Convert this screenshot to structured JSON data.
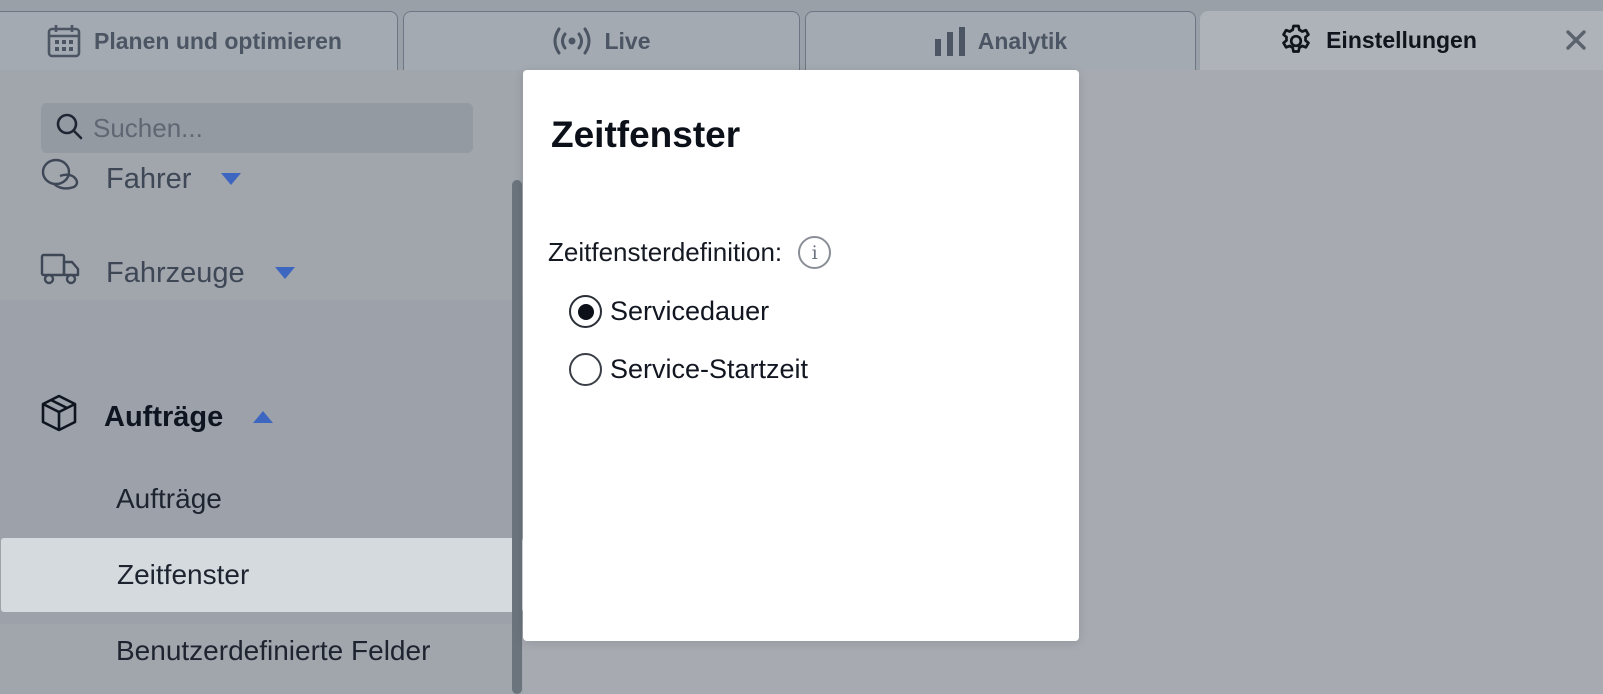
{
  "tabs": [
    {
      "label": "Planen und optimieren",
      "icon": "calendar-icon"
    },
    {
      "label": "Live",
      "icon": "broadcast-icon"
    },
    {
      "label": "Analytik",
      "icon": "bar-chart-icon"
    },
    {
      "label": "Einstellungen",
      "icon": "gear-icon",
      "active": true
    }
  ],
  "search": {
    "placeholder": "Suchen..."
  },
  "sidebar": {
    "items": [
      {
        "label": "Fahrer",
        "icon": "driver-icon",
        "expanded": false
      },
      {
        "label": "Fahrzeuge",
        "icon": "truck-icon",
        "expanded": false
      },
      {
        "label": "Aufträge",
        "icon": "package-icon",
        "expanded": true
      }
    ],
    "subitems": [
      {
        "label": "Aufträge"
      },
      {
        "label": "Zeitfenster",
        "selected": true
      },
      {
        "label": "Benutzerdefinierte Felder"
      }
    ]
  },
  "modal": {
    "title": "Zeitfenster",
    "field_label": "Zeitfensterdefinition:",
    "info_glyph": "i",
    "options": [
      {
        "label": "Servicedauer",
        "checked": true
      },
      {
        "label": "Service-Startzeit",
        "checked": false
      }
    ]
  },
  "colors": {
    "accent": "#3c66c0",
    "selected_bg": "#d5dade",
    "modal_bg": "#ffffff"
  }
}
